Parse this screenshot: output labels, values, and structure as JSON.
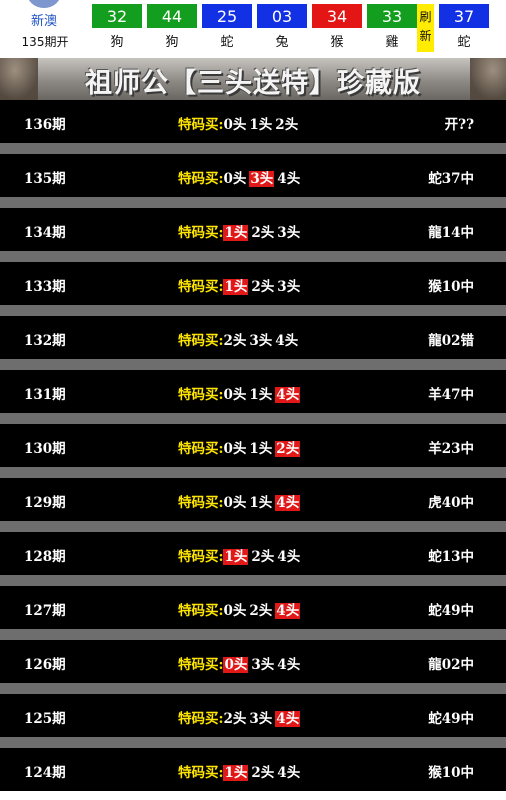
{
  "header": {
    "site_name": "新澳",
    "issue_label": "135期开",
    "refresh_label_1": "刷",
    "refresh_label_2": "新",
    "balls": [
      {
        "number": "32",
        "zodiac": "狗",
        "color": "#149e1f"
      },
      {
        "number": "44",
        "zodiac": "狗",
        "color": "#149e1f"
      },
      {
        "number": "25",
        "zodiac": "蛇",
        "color": "#1231e4"
      },
      {
        "number": "03",
        "zodiac": "兔",
        "color": "#1231e4"
      },
      {
        "number": "34",
        "zodiac": "猴",
        "color": "#e31515"
      },
      {
        "number": "33",
        "zodiac": "雞",
        "color": "#149e1f"
      },
      {
        "number": "37",
        "zodiac": "蛇",
        "color": "#1231e4"
      }
    ]
  },
  "banner": {
    "title": "祖师公【三头送特】珍藏版"
  },
  "colors": {
    "pick_label": "#ffe600",
    "highlight": "#e01818",
    "separator": "#6e6e6e"
  },
  "rows": [
    {
      "issue": "136期",
      "label": "特码买:",
      "heads": [
        "0头",
        "1头",
        "2头"
      ],
      "hit": -1,
      "result": "开??"
    },
    {
      "issue": "135期",
      "label": "特码买:",
      "heads": [
        "0头",
        "3头",
        "4头"
      ],
      "hit": 1,
      "result": "蛇37中"
    },
    {
      "issue": "134期",
      "label": "特码买:",
      "heads": [
        "1头",
        "2头",
        "3头"
      ],
      "hit": 0,
      "result": "龍14中"
    },
    {
      "issue": "133期",
      "label": "特码买:",
      "heads": [
        "1头",
        "2头",
        "3头"
      ],
      "hit": 0,
      "result": "猴10中"
    },
    {
      "issue": "132期",
      "label": "特码买:",
      "heads": [
        "2头",
        "3头",
        "4头"
      ],
      "hit": -1,
      "result": "龍02错"
    },
    {
      "issue": "131期",
      "label": "特码买:",
      "heads": [
        "0头",
        "1头",
        "4头"
      ],
      "hit": 2,
      "result": "羊47中"
    },
    {
      "issue": "130期",
      "label": "特码买:",
      "heads": [
        "0头",
        "1头",
        "2头"
      ],
      "hit": 2,
      "result": "羊23中"
    },
    {
      "issue": "129期",
      "label": "特码买:",
      "heads": [
        "0头",
        "1头",
        "4头"
      ],
      "hit": 2,
      "result": "虎40中"
    },
    {
      "issue": "128期",
      "label": "特码买:",
      "heads": [
        "1头",
        "2头",
        "4头"
      ],
      "hit": 0,
      "result": "蛇13中"
    },
    {
      "issue": "127期",
      "label": "特码买:",
      "heads": [
        "0头",
        "2头",
        "4头"
      ],
      "hit": 2,
      "result": "蛇49中"
    },
    {
      "issue": "126期",
      "label": "特码买:",
      "heads": [
        "0头",
        "3头",
        "4头"
      ],
      "hit": 0,
      "result": "龍02中"
    },
    {
      "issue": "125期",
      "label": "特码买:",
      "heads": [
        "2头",
        "3头",
        "4头"
      ],
      "hit": 2,
      "result": "蛇49中"
    },
    {
      "issue": "124期",
      "label": "特码买:",
      "heads": [
        "1头",
        "2头",
        "4头"
      ],
      "hit": 0,
      "result": "猴10中"
    }
  ]
}
